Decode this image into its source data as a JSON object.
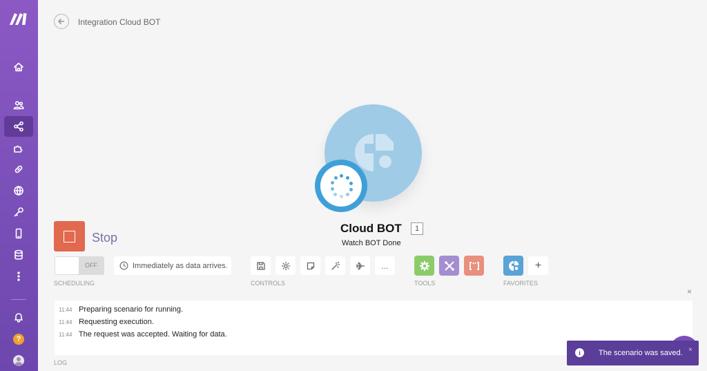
{
  "header": {
    "title": "Integration Cloud BOT"
  },
  "sidebar": {
    "items": [
      {
        "icon": "home-icon"
      },
      {
        "icon": "team-icon"
      },
      {
        "icon": "scenarios-icon",
        "active": true
      },
      {
        "icon": "templates-icon"
      },
      {
        "icon": "connections-icon"
      },
      {
        "icon": "webhooks-icon"
      },
      {
        "icon": "keys-icon"
      },
      {
        "icon": "devices-icon"
      },
      {
        "icon": "datastores-icon"
      },
      {
        "icon": "more-icon"
      }
    ],
    "help": "?"
  },
  "module": {
    "name": "Cloud BOT",
    "count": "1",
    "subtitle": "Watch BOT Done",
    "color": "#9fcbe6",
    "badge_color": "#3f9fd8"
  },
  "run": {
    "stop_label": "Stop",
    "stop_color": "#e1694e"
  },
  "scheduling": {
    "toggle_label": "OFF",
    "schedule_text": "Immediately as data arrives.",
    "section_label": "SCHEDULING"
  },
  "controls": {
    "section_label": "CONTROLS",
    "buttons": [
      "save-icon",
      "settings-icon",
      "notes-icon",
      "auto-align-icon",
      "flow-icon",
      "more-icon"
    ],
    "more_label": "..."
  },
  "tools": {
    "section_label": "TOOLS",
    "items": [
      {
        "icon": "flow-control-gear-icon",
        "color": "#8ccb6a"
      },
      {
        "icon": "tools-icon",
        "color": "#a58dd1"
      },
      {
        "icon": "text-parser-icon",
        "color": "#e88f7e"
      }
    ]
  },
  "favorites": {
    "section_label": "FAVORITES",
    "items": [
      {
        "icon": "cloud-bot-icon",
        "color": "#5aa3d6"
      }
    ],
    "add_label": "+"
  },
  "log": {
    "close_label": "×",
    "section_label": "LOG",
    "entries": [
      {
        "time": "11:44",
        "text": "Preparing scenario for running."
      },
      {
        "time": "11:44",
        "text": "Requesting execution."
      },
      {
        "time": "11:44",
        "text": "The request was accepted. Waiting for data."
      }
    ]
  },
  "toast": {
    "text": "The scenario was saved.",
    "close_label": "×",
    "icon": "info-icon",
    "color": "#5b3d9a"
  }
}
